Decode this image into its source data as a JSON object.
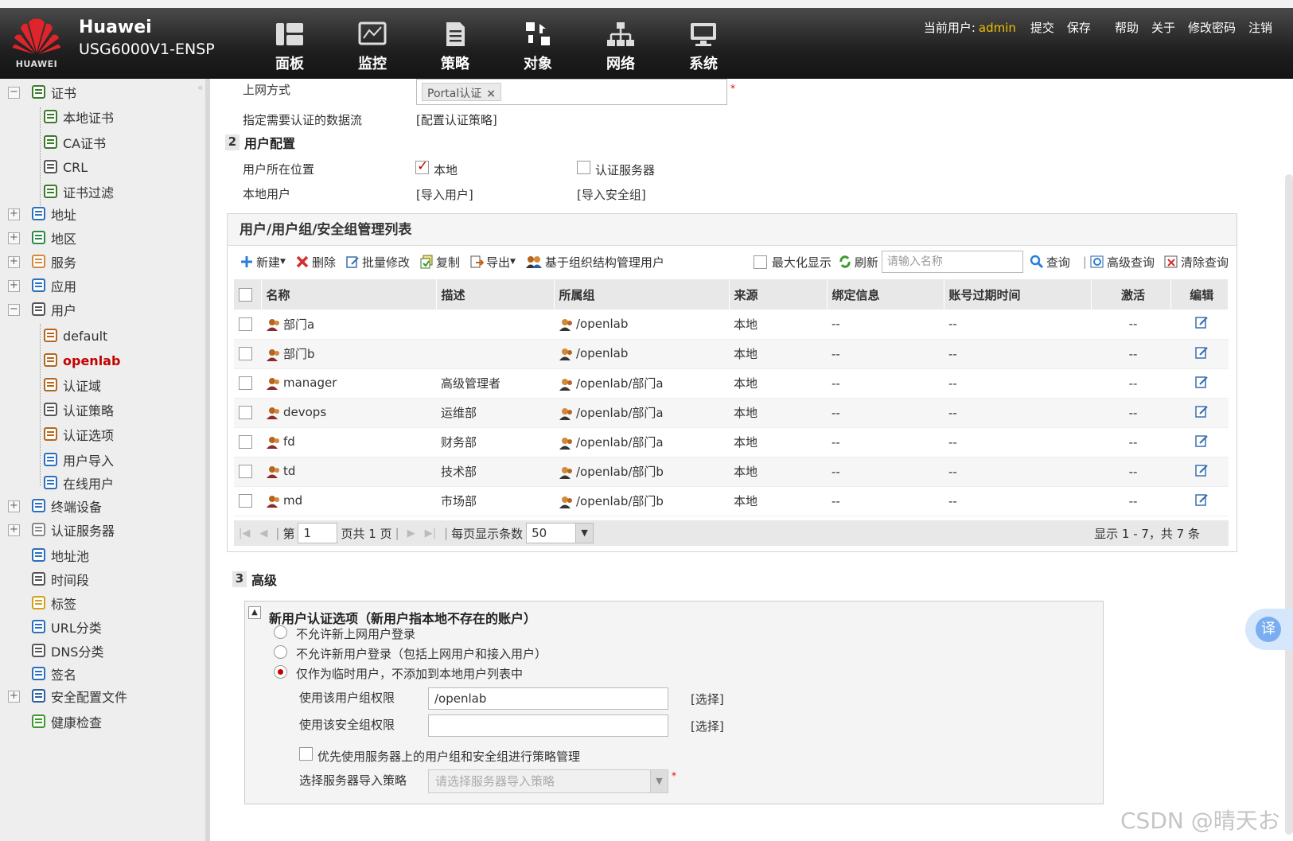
{
  "header": {
    "brand_name": "Huawei",
    "brand_model": "USG6000V1-ENSP",
    "logo_text": "HUAWEI",
    "nav": [
      {
        "label": "面板",
        "icon": "dashboard-icon"
      },
      {
        "label": "监控",
        "icon": "monitor-icon"
      },
      {
        "label": "策略",
        "icon": "policy-icon"
      },
      {
        "label": "对象",
        "icon": "object-icon"
      },
      {
        "label": "网络",
        "icon": "network-icon"
      },
      {
        "label": "系统",
        "icon": "system-icon"
      }
    ],
    "current_user_label": "当前用户:",
    "current_user": "admin",
    "links": [
      "提交",
      "保存",
      "帮助",
      "关于",
      "修改密码",
      "注销"
    ]
  },
  "sidebar": {
    "items": [
      {
        "label": "证书",
        "toggle": "−",
        "level": 0
      },
      {
        "label": "本地证书",
        "level": 1
      },
      {
        "label": "CA证书",
        "level": 1
      },
      {
        "label": "CRL",
        "level": 1
      },
      {
        "label": "证书过滤",
        "level": 1
      },
      {
        "label": "地址",
        "toggle": "+",
        "level": 0
      },
      {
        "label": "地区",
        "toggle": "+",
        "level": 0
      },
      {
        "label": "服务",
        "toggle": "+",
        "level": 0
      },
      {
        "label": "应用",
        "toggle": "+",
        "level": 0
      },
      {
        "label": "用户",
        "toggle": "−",
        "level": 0
      },
      {
        "label": "default",
        "level": 1
      },
      {
        "label": "openlab",
        "level": 1,
        "active": true
      },
      {
        "label": "认证域",
        "level": 1
      },
      {
        "label": "认证策略",
        "level": 1
      },
      {
        "label": "认证选项",
        "level": 1
      },
      {
        "label": "用户导入",
        "level": 1
      },
      {
        "label": "在线用户",
        "level": 1
      },
      {
        "label": "终端设备",
        "toggle": "+",
        "level": 0
      },
      {
        "label": "认证服务器",
        "toggle": "+",
        "level": 0
      },
      {
        "label": "地址池",
        "level": 0
      },
      {
        "label": "时间段",
        "level": 0
      },
      {
        "label": "标签",
        "level": 0
      },
      {
        "label": "URL分类",
        "level": 0
      },
      {
        "label": "DNS分类",
        "level": 0
      },
      {
        "label": "签名",
        "level": 0
      },
      {
        "label": "安全配置文件",
        "toggle": "+",
        "level": 0
      },
      {
        "label": "健康检查",
        "level": 0
      }
    ]
  },
  "form": {
    "access_mode_label": "上网方式",
    "access_mode_tag": "Portal认证",
    "data_flow_label": "指定需要认证的数据流",
    "data_flow_link": "[配置认证策略]",
    "section2_num": "2",
    "section2_title": "用户配置",
    "user_location_label": "用户所在位置",
    "location_local": "本地",
    "location_server": "认证服务器",
    "local_user_label": "本地用户",
    "import_user_link": "[导入用户]",
    "import_secgroup_link": "[导入安全组]"
  },
  "grid": {
    "title": "用户/用户组/安全组管理列表",
    "toolbar": {
      "new": "新建",
      "delete": "删除",
      "batch_edit": "批量修改",
      "copy": "复制",
      "export": "导出",
      "org_manage": "基于组织结构管理用户",
      "maximize": "最大化显示",
      "refresh": "刷新",
      "search_placeholder": "请输入名称",
      "query": "查询",
      "advanced_query": "高级查询",
      "clear_query": "清除查询"
    },
    "columns": [
      "名称",
      "描述",
      "所属组",
      "来源",
      "绑定信息",
      "账号过期时间",
      "激活",
      "编辑"
    ],
    "rows": [
      {
        "name": "部门a",
        "desc": "",
        "group": "/openlab",
        "source": "本地",
        "bind": "--",
        "expire": "--",
        "active": "--"
      },
      {
        "name": "部门b",
        "desc": "",
        "group": "/openlab",
        "source": "本地",
        "bind": "--",
        "expire": "--",
        "active": "--"
      },
      {
        "name": "manager",
        "desc": "高级管理者",
        "group": "/openlab/部门a",
        "source": "本地",
        "bind": "--",
        "expire": "--",
        "active": "--"
      },
      {
        "name": "devops",
        "desc": "运维部",
        "group": "/openlab/部门a",
        "source": "本地",
        "bind": "--",
        "expire": "--",
        "active": "--"
      },
      {
        "name": "fd",
        "desc": "财务部",
        "group": "/openlab/部门a",
        "source": "本地",
        "bind": "--",
        "expire": "--",
        "active": "--"
      },
      {
        "name": "td",
        "desc": "技术部",
        "group": "/openlab/部门b",
        "source": "本地",
        "bind": "--",
        "expire": "--",
        "active": "--"
      },
      {
        "name": "md",
        "desc": "市场部",
        "group": "/openlab/部门b",
        "source": "本地",
        "bind": "--",
        "expire": "--",
        "active": "--"
      }
    ],
    "pager": {
      "page_prefix": "第",
      "page_value": "1",
      "page_suffix": "页共 1 页",
      "per_page_label": "每页显示条数",
      "per_page_value": "50",
      "summary": "显示 1 - 7，共 7 条"
    }
  },
  "advanced": {
    "section3_num": "3",
    "section3_title": "高级",
    "box_title": "新用户认证选项（新用户指本地不存在的账户）",
    "opt1": "不允许新上网用户登录",
    "opt2": "不允许新用户登录（包括上网用户和接入用户）",
    "opt3": "仅作为临时用户，不添加到本地用户列表中",
    "usergroup_label": "使用该用户组权限",
    "usergroup_value": "/openlab",
    "secgroup_label": "使用该安全组权限",
    "secgroup_value": "",
    "select_link": "[选择]",
    "prefer_server_label": "优先使用服务器上的用户组和安全组进行策略管理",
    "import_policy_label": "选择服务器导入策略",
    "import_policy_placeholder": "请选择服务器导入策略"
  },
  "misc": {
    "translate": "译",
    "watermark": "CSDN @晴天お"
  }
}
